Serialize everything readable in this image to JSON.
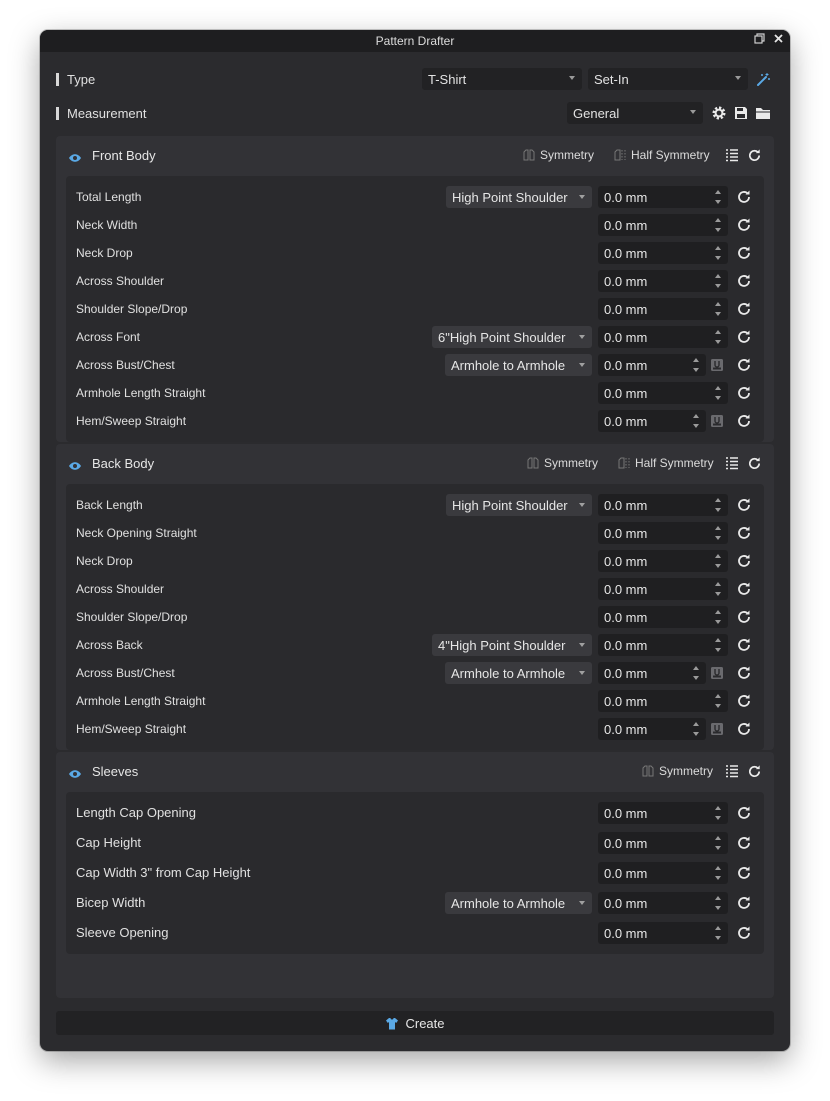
{
  "window": {
    "title": "Pattern Drafter"
  },
  "type_row": {
    "label": "Type",
    "garment": "T-Shirt",
    "sleeve": "Set-In"
  },
  "measurement_row": {
    "label": "Measurement",
    "system": "General"
  },
  "front": {
    "title": "Front Body",
    "symmetry": "Symmetry",
    "half_symmetry": "Half Symmetry",
    "rows": [
      {
        "label": "Total Length",
        "select": "High Point Shoulder",
        "value": "0.0 mm"
      },
      {
        "label": "Neck Width",
        "value": "0.0 mm"
      },
      {
        "label": "Neck Drop",
        "value": "0.0 mm"
      },
      {
        "label": "Across Shoulder",
        "value": "0.0 mm"
      },
      {
        "label": "Shoulder Slope/Drop",
        "value": "0.0 mm"
      },
      {
        "label": "Across Font",
        "select": "6\"High Point Shoulder",
        "value": "0.0 mm"
      },
      {
        "label": "Across Bust/Chest",
        "select": "Armhole to Armhole",
        "value": "0.0 mm",
        "lock": true
      },
      {
        "label": "Armhole Length Straight",
        "value": "0.0 mm"
      },
      {
        "label": "Hem/Sweep Straight",
        "value": "0.0 mm",
        "lock": true
      }
    ]
  },
  "back": {
    "title": "Back Body",
    "symmetry": "Symmetry",
    "half_symmetry": "Half Symmetry",
    "rows": [
      {
        "label": "Back Length",
        "select": "High Point Shoulder",
        "value": "0.0 mm"
      },
      {
        "label": "Neck Opening Straight",
        "value": "0.0 mm"
      },
      {
        "label": "Neck Drop",
        "value": "0.0 mm"
      },
      {
        "label": "Across Shoulder",
        "value": "0.0 mm"
      },
      {
        "label": "Shoulder Slope/Drop",
        "value": "0.0 mm"
      },
      {
        "label": "Across Back",
        "select": "4\"High Point Shoulder",
        "value": "0.0 mm"
      },
      {
        "label": "Across Bust/Chest",
        "select": "Armhole to Armhole",
        "value": "0.0 mm",
        "lock": true
      },
      {
        "label": "Armhole Length Straight",
        "value": "0.0 mm"
      },
      {
        "label": "Hem/Sweep Straight",
        "value": "0.0 mm",
        "lock": true
      }
    ]
  },
  "sleeves": {
    "title": "Sleeves",
    "symmetry": "Symmetry",
    "rows": [
      {
        "label": "Length Cap Opening",
        "value": "0.0 mm"
      },
      {
        "label": "Cap Height",
        "value": "0.0 mm"
      },
      {
        "label": "Cap Width 3\" from Cap Height",
        "value": "0.0 mm"
      },
      {
        "label": "Bicep Width",
        "select": "Armhole to Armhole",
        "value": "0.0 mm"
      },
      {
        "label": "Sleeve Opening",
        "value": "0.0 mm"
      }
    ]
  },
  "create_label": "Create",
  "colors": {
    "accent": "#5aa9e6",
    "window_bg": "#2b2b2e",
    "panel_bg": "#323236"
  }
}
